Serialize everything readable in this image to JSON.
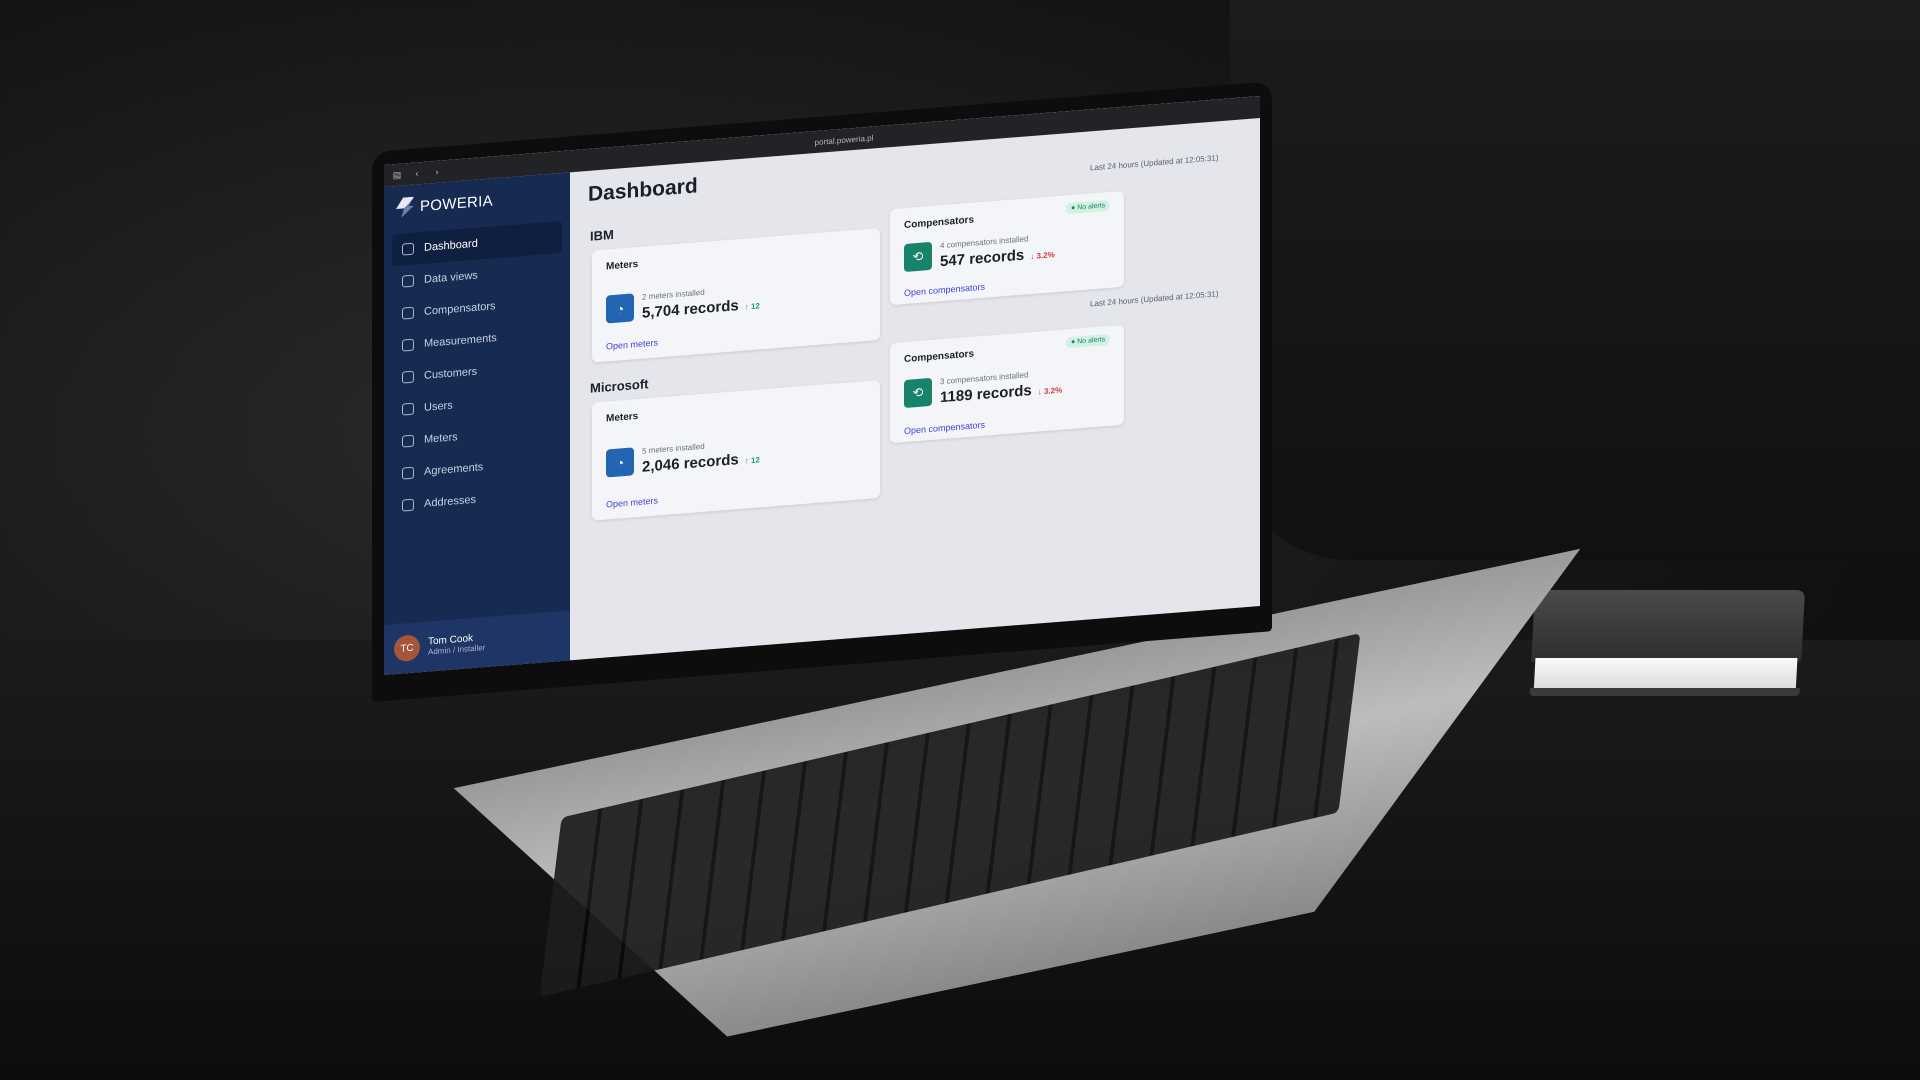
{
  "browser": {
    "url": "portal.poweria.pl"
  },
  "brand": {
    "name": "POWERIA"
  },
  "sidebar": {
    "items": [
      {
        "label": "Dashboard",
        "icon": "home-icon"
      },
      {
        "label": "Data views",
        "icon": "chart-pie-icon"
      },
      {
        "label": "Compensators",
        "icon": "compensator-icon"
      },
      {
        "label": "Measurements",
        "icon": "table-icon"
      },
      {
        "label": "Customers",
        "icon": "id-card-icon"
      },
      {
        "label": "Users",
        "icon": "users-icon"
      },
      {
        "label": "Meters",
        "icon": "gauge-icon"
      },
      {
        "label": "Agreements",
        "icon": "document-icon"
      },
      {
        "label": "Addresses",
        "icon": "map-icon"
      }
    ],
    "active": "Dashboard"
  },
  "user": {
    "initials": "TC",
    "name": "Tom Cook",
    "role": "Admin / Installer"
  },
  "main": {
    "title": "Dashboard",
    "sections": [
      {
        "company": "IBM",
        "updated": "Last 24 hours (Updated at 12:05:31)",
        "meters": {
          "title": "Meters",
          "sub": "2 meters installed",
          "value": "5,704 records",
          "delta": "12",
          "link": "Open meters"
        },
        "compensators": {
          "title": "Compensators",
          "badge": "No alerts",
          "sub": "4 compensators installed",
          "value": "547 records",
          "delta": "3.2%",
          "link": "Open compensators"
        }
      },
      {
        "company": "Microsoft",
        "updated": "Last 24 hours (Updated at 12:05:31)",
        "meters": {
          "title": "Meters",
          "sub": "5 meters installed",
          "value": "2,046 records",
          "delta": "12",
          "link": "Open meters"
        },
        "compensators": {
          "title": "Compensators",
          "badge": "No alerts",
          "sub": "3 compensators installed",
          "value": "1189 records",
          "delta": "3.2%",
          "link": "Open compensators"
        }
      }
    ]
  },
  "colors": {
    "sidebar": "#172a52",
    "accent_blue": "#2365b3",
    "accent_green": "#16836a",
    "link": "#3b3fd6",
    "up": "#1aa36b",
    "down": "#d13a3a"
  }
}
